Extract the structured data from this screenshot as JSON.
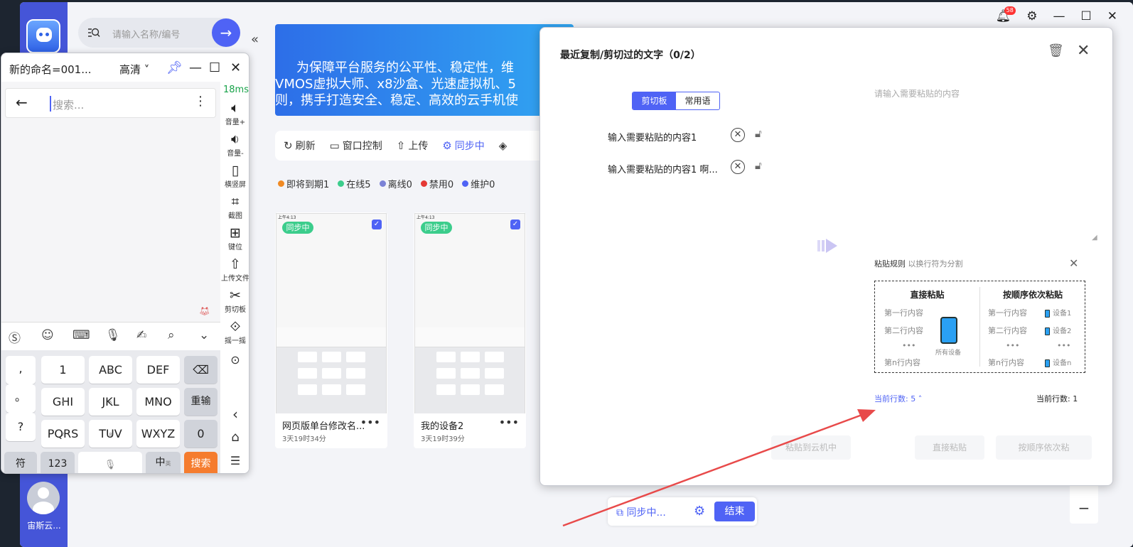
{
  "search": {
    "placeholder": "请输入名称/编号"
  },
  "sidebar": {
    "username": "宙斯云..."
  },
  "banner": {
    "lines": [
      "为保障平台服务的公平性、稳定性，维",
      "VMOS虚拟大师、x8沙盒、光速虚拟机、5",
      "则，携手打造安全、稳定、高效的云手机使"
    ]
  },
  "toolbar": {
    "refresh": "刷新",
    "window_control": "窗口控制",
    "upload": "上传",
    "syncing": "同步中"
  },
  "status": {
    "expiring": "即将到期1",
    "online": "在线5",
    "offline": "离线0",
    "disabled": "禁用0",
    "maintenance": "维护0"
  },
  "status_colors": {
    "expiring": "#f08a24",
    "online": "#3ccd8c",
    "offline": "#7b82d6",
    "disabled": "#e53935",
    "maintenance": "#4f63f5"
  },
  "devices": [
    {
      "name": "网页版单台修改名...",
      "time": "3天19时34分",
      "badge": "同步中",
      "statusbar": "上午4:13"
    },
    {
      "name": "我的设备2",
      "time": "3天19时39分",
      "badge": "同步中",
      "statusbar": "上午4:13"
    }
  ],
  "bottombar": {
    "syncing": "同步中...",
    "end": "结束"
  },
  "topbar": {
    "notif_count": "58"
  },
  "phone_window": {
    "title": "新的命名=001...",
    "quality": "高清",
    "latency": "18ms",
    "search_placeholder": "搜索...",
    "side_buttons": [
      "音量+",
      "音量-",
      "横竖屏",
      "截图",
      "键位",
      "上传文件",
      "剪切板",
      "摇一摇"
    ],
    "keys": {
      "punct": [
        ",",
        "。",
        "?",
        "!"
      ],
      "row1": [
        "1",
        "ABC",
        "DEF"
      ],
      "row2": [
        "GHI",
        "JKL",
        "MNO"
      ],
      "row3": [
        "PQRS",
        "TUV",
        "WXYZ"
      ],
      "sup1": [
        "",
        "2",
        "3"
      ],
      "sup2": [
        "4",
        "5",
        "6"
      ],
      "sup3": [
        "7",
        "8",
        "9"
      ],
      "reenter": "重输",
      "zero": "0",
      "symbol": "符",
      "num": "123",
      "zh": "中",
      "en": "英",
      "search": "搜索"
    }
  },
  "dialog": {
    "title": "最近复制/剪切过的文字（0/2）",
    "tabs": [
      "剪切板",
      "常用语"
    ],
    "items": [
      "输入需要粘贴的内容1",
      "输入需要粘贴的内容1 啊..."
    ],
    "paste_placeholder": "请输入需要粘贴的内容",
    "rules_title": "粘贴规则",
    "rules_sub": "以换行符为分割",
    "direct": {
      "title": "直接粘贴",
      "lines": [
        "第一行内容",
        "第二行内容",
        "•••",
        "第n行内容"
      ],
      "device": "所有设备"
    },
    "sequential": {
      "title": "按顺序依次粘贴",
      "lines": [
        "第一行内容",
        "第二行内容",
        "•••",
        "第n行内容"
      ],
      "devices": [
        "设备1",
        "设备2",
        "•••",
        "设备n"
      ]
    },
    "row_count_left": "当前行数: 5 ˄",
    "row_count_right": "当前行数: 1",
    "buttons": {
      "paste_to_cloud": "粘贴到云机中",
      "direct_paste": "直接粘贴",
      "seq_paste": "按顺序依次粘"
    }
  }
}
